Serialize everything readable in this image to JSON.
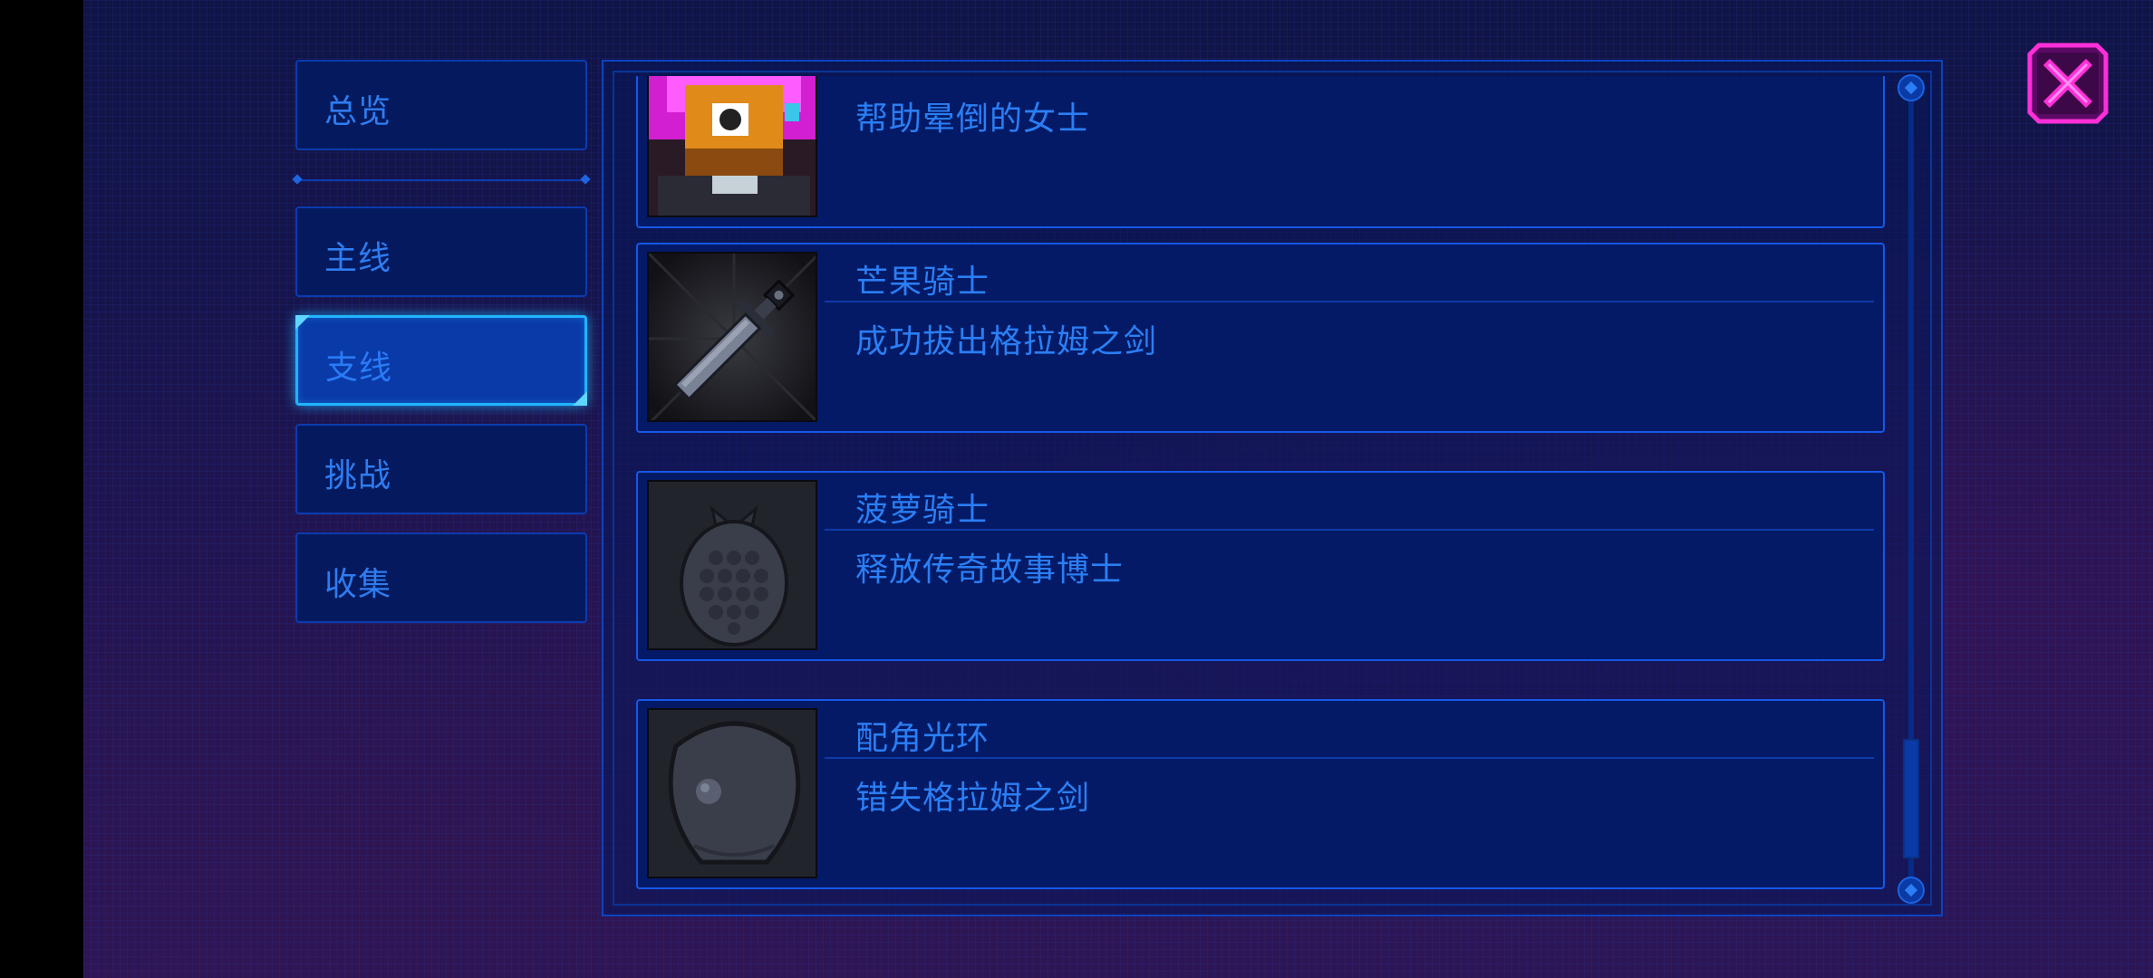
{
  "sidebar": {
    "overview_label": "总览",
    "tabs": [
      {
        "label": "主线",
        "active": false
      },
      {
        "label": "支线",
        "active": true
      },
      {
        "label": "挑战",
        "active": false
      },
      {
        "label": "收集",
        "active": false
      }
    ]
  },
  "quests": [
    {
      "title": "",
      "description": "帮助晕倒的女士",
      "icon": "wizard-portrait-icon"
    },
    {
      "title": "芒果骑士",
      "description": "成功拔出格拉姆之剑",
      "icon": "sword-icon"
    },
    {
      "title": "菠萝骑士",
      "description": "释放传奇故事博士",
      "icon": "pineapple-icon"
    },
    {
      "title": "配角光环",
      "description": "错失格拉姆之剑",
      "icon": "bubble-icon"
    }
  ],
  "colors": {
    "accent": "#2b7ef4",
    "active_border": "#20b4ff",
    "close_accent": "#ff2fd8"
  }
}
